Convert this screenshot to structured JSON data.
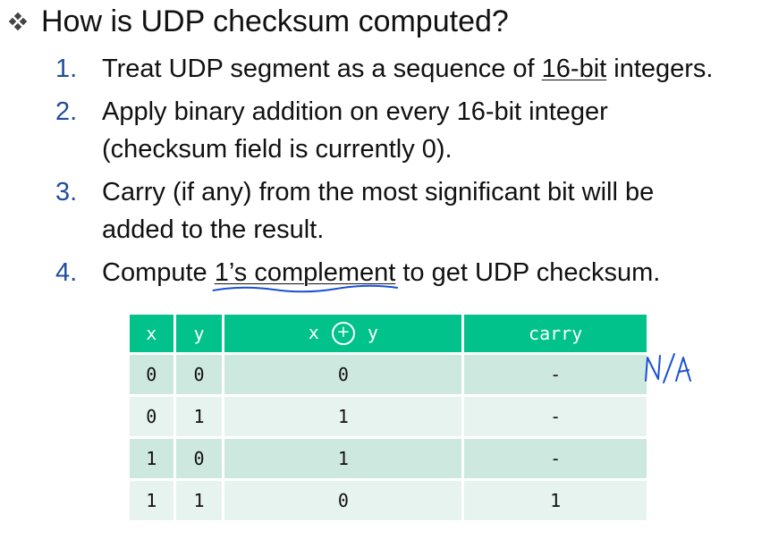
{
  "heading": {
    "text": "How is UDP checksum computed?"
  },
  "steps": [
    {
      "num": "1.",
      "pre": "Treat UDP segment as a sequence of ",
      "u": "16-bit",
      "post": " integers."
    },
    {
      "num": "2.",
      "line1": "Apply binary addition on every 16-bit integer",
      "line2": "(checksum field is currently 0)."
    },
    {
      "num": "3.",
      "line1": "Carry (if any) from the most significant bit will be",
      "line2": "added to the result."
    },
    {
      "num": "4.",
      "pre": "Compute ",
      "u": "1’s complement",
      "post": " to get UDP checksum."
    }
  ],
  "table": {
    "headers": {
      "x": "x",
      "y": "y",
      "xor_x": "x",
      "xor_sym": "+",
      "xor_y": "y",
      "carry": "carry"
    },
    "rows": [
      [
        "0",
        "0",
        "0",
        "-"
      ],
      [
        "0",
        "1",
        "1",
        "-"
      ],
      [
        "1",
        "0",
        "1",
        "-"
      ],
      [
        "1",
        "1",
        "0",
        "1"
      ]
    ]
  },
  "annotation": {
    "text": "N/A",
    "color": "#1a4fd6"
  },
  "colors": {
    "header_bg": "#00c28a",
    "row_dark": "#cde8de",
    "row_light": "#e6f3ee",
    "number": "#1f4e9a"
  }
}
